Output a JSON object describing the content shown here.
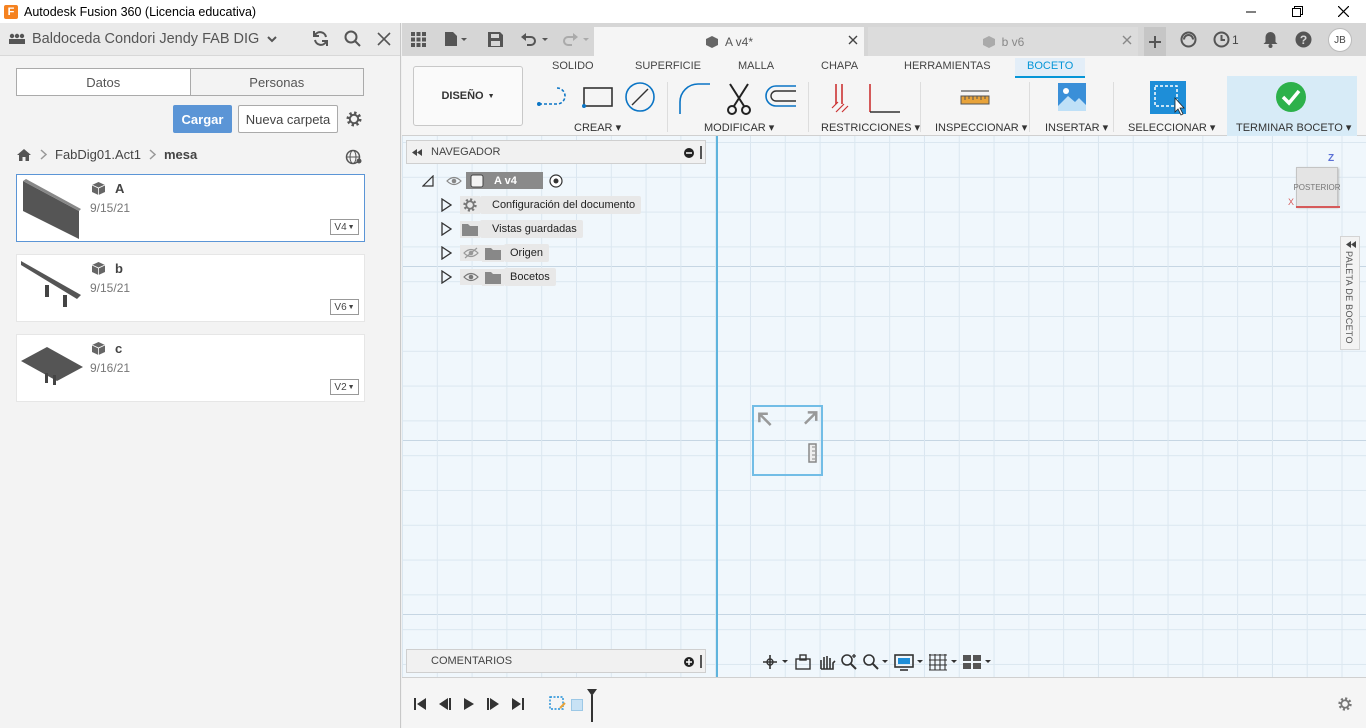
{
  "window": {
    "title": "Autodesk Fusion 360 (Licencia educativa)",
    "logo_letter": "F"
  },
  "data_panel": {
    "team": "Baldoceda Condori Jendy FAB DIG",
    "tabs": [
      "Datos",
      "Personas"
    ],
    "upload_label": "Cargar",
    "new_folder_label": "Nueva carpeta",
    "breadcrumb": [
      "FabDig01.Act1",
      "mesa"
    ],
    "files": [
      {
        "name": "A",
        "date": "9/15/21",
        "version": "V4"
      },
      {
        "name": "b",
        "date": "9/15/21",
        "version": "V6"
      },
      {
        "name": "c",
        "date": "9/16/21",
        "version": "V2"
      }
    ]
  },
  "doc_tabs": [
    {
      "label": "A v4*"
    },
    {
      "label": "b v6"
    }
  ],
  "top_right": {
    "jobs_count": "1",
    "user_initials": "JB"
  },
  "toolbar": {
    "workspace": "DISEÑO",
    "workspace_tabs": [
      "SOLIDO",
      "SUPERFICIE",
      "MALLA",
      "CHAPA",
      "HERRAMIENTAS",
      "BOCETO"
    ],
    "active_tab": "BOCETO",
    "groups": [
      "CREAR",
      "MODIFICAR",
      "RESTRICCIONES",
      "INSPECCIONAR",
      "INSERTAR",
      "SELECCIONAR",
      "TERMINAR BOCETO"
    ],
    "accent": "#0696d7",
    "finish_color": "#2db14b"
  },
  "navigator": {
    "title": "NAVEGADOR",
    "root": "A v4",
    "items": [
      "Configuración del documento",
      "Vistas guardadas",
      "Origen",
      "Bocetos"
    ]
  },
  "comments": {
    "title": "COMENTARIOS"
  },
  "viewcube": {
    "face": "POSTERIOR",
    "axis_z": "Z",
    "axis_x": "X"
  },
  "sketch_palette": {
    "label": "PALETA DE BOCETO"
  }
}
